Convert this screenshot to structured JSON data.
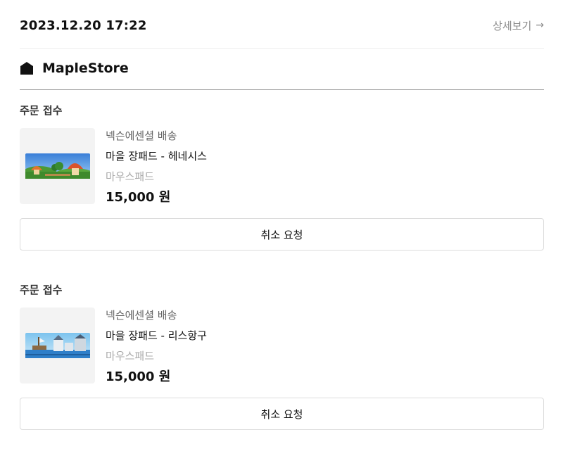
{
  "header": {
    "datetime": "2023.12.20 17:22",
    "detail_label": "상세보기",
    "detail_arrow": "→"
  },
  "store": {
    "name": "MapleStore"
  },
  "orders": [
    {
      "status": "주문 접수",
      "shipping": "넥슨에센셜 배송",
      "name": "마을 장패드 - 헤네시스",
      "category": "마우스패드",
      "price": "15,000 원",
      "cancel_label": "취소 요청",
      "image_icon": "henesys-mousepad-image"
    },
    {
      "status": "주문 접수",
      "shipping": "넥슨에센셜 배송",
      "name": "마을 장패드 - 리스항구",
      "category": "마우스패드",
      "price": "15,000 원",
      "cancel_label": "취소 요청",
      "image_icon": "lith-harbor-mousepad-image"
    }
  ]
}
